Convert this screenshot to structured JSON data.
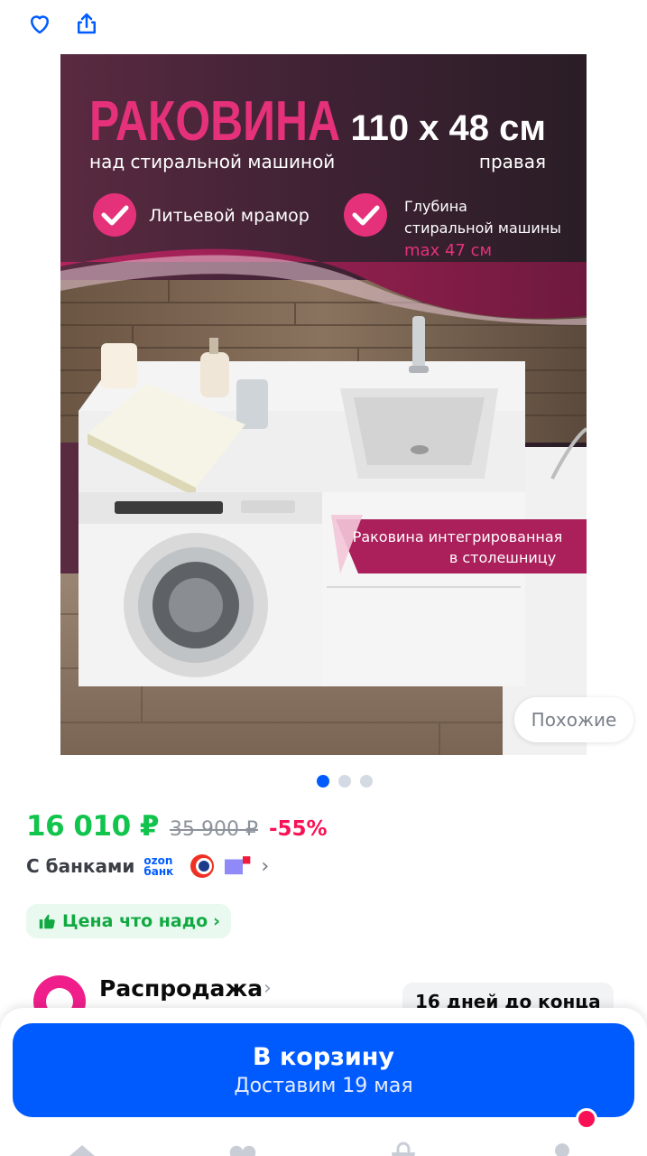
{
  "topbar": {
    "favorite_icon": "heart-outline-icon",
    "share_icon": "share-icon"
  },
  "product_image": {
    "headline": "РАКОВИНА",
    "subline": "над стиральной машиной",
    "size": "110 x 48 см",
    "side": "правая",
    "feature_1": "Литьевой мрамор",
    "feature_2_line1": "Глубина",
    "feature_2_line2": "стиральной машины",
    "feature_2_line3": "max 47 см",
    "banner_line1": "Раковина интегрированная",
    "banner_line2": "в столешницу"
  },
  "similar_button": "Похожие",
  "gallery": {
    "count": 3,
    "active": 1
  },
  "price": {
    "current": "16 010 ₽",
    "old": "35 900 ₽",
    "discount": "-55%"
  },
  "banks": {
    "label": "С банками",
    "ozon_line1": "ozon",
    "ozon_line2": "банк"
  },
  "badge": {
    "label": "Цена что надо"
  },
  "sale": {
    "title": "Распродажа",
    "countdown": "16 дней до конца"
  },
  "cart": {
    "title": "В корзину",
    "delivery": "Доставим 19 мая"
  },
  "colors": {
    "accent": "#005bff",
    "price": "#10c44c",
    "discount": "#f91155",
    "pink": "#e5317a"
  }
}
